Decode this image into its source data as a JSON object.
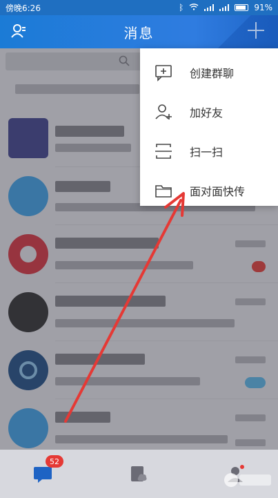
{
  "status_bar": {
    "time": "傍晚6:26",
    "battery": "91%"
  },
  "header": {
    "title": "消息",
    "contacts_icon": "contacts-icon",
    "add_icon": "plus-icon"
  },
  "popup_menu": {
    "items": [
      {
        "label": "创建群聊",
        "icon": "group-chat-icon"
      },
      {
        "label": "加好友",
        "icon": "add-friend-icon"
      },
      {
        "label": "扫一扫",
        "icon": "scan-icon"
      },
      {
        "label": "面对面快传",
        "icon": "folder-icon"
      }
    ]
  },
  "conversation_list": {
    "items": [
      {
        "badge_color": "",
        "avatar_color": "#3b3f8c"
      },
      {
        "badge_color": "",
        "avatar_color": "#3aa0e8"
      },
      {
        "badge_color": "#e53935",
        "avatar_color": "#d9303c"
      },
      {
        "badge_color": "",
        "avatar_color": "#2b2b2b"
      },
      {
        "badge_color": "#57b7ea",
        "avatar_color": "#1a4a83"
      },
      {
        "badge_color": "",
        "avatar_color": "#3aa0e8"
      }
    ]
  },
  "tab_bar": {
    "message_badge": "52",
    "tabs": [
      {
        "icon": "message-icon"
      },
      {
        "icon": "workbench-icon"
      },
      {
        "icon": "profile-icon"
      }
    ]
  },
  "colors": {
    "brand_blue": "#1f6fc1",
    "arrow_red": "#e53935"
  }
}
